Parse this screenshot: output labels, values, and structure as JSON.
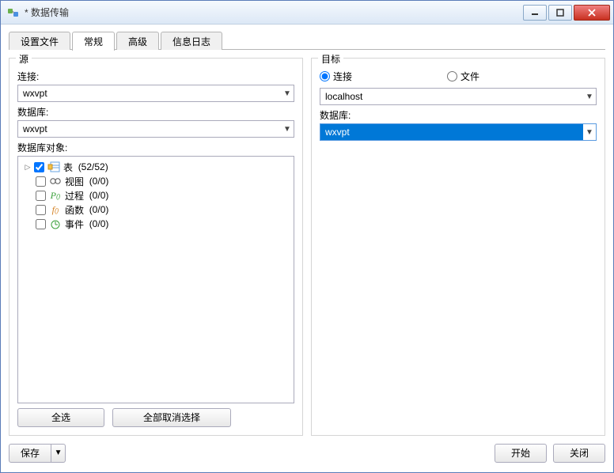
{
  "window": {
    "title": "* 数据传输"
  },
  "tabs": {
    "t0": "设置文件",
    "t1": "常规",
    "t2": "高级",
    "t3": "信息日志",
    "active": 1
  },
  "source": {
    "legend": "源",
    "connection_label": "连接:",
    "connection_value": "wxvpt",
    "database_label": "数据库:",
    "database_value": "wxvpt",
    "objects_label": "数据库对象:",
    "tree": {
      "tables": {
        "label": "表",
        "count": "(52/52)"
      },
      "views": {
        "label": "视图",
        "count": "(0/0)"
      },
      "procs": {
        "label": "过程",
        "count": "(0/0)"
      },
      "funcs": {
        "label": "函数",
        "count": "(0/0)"
      },
      "events": {
        "label": "事件",
        "count": "(0/0)"
      }
    },
    "select_all": "全选",
    "deselect_all": "全部取消选择"
  },
  "target": {
    "legend": "目标",
    "radio_connection": "连接",
    "radio_file": "文件",
    "connection_value": "localhost",
    "database_label": "数据库:",
    "database_value": "wxvpt"
  },
  "footer": {
    "save": "保存",
    "start": "开始",
    "close": "关闭"
  }
}
